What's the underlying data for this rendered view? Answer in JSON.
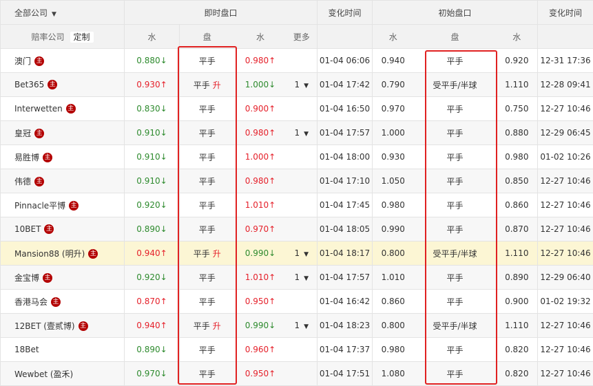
{
  "header": {
    "all_companies": "全部公司",
    "live": "即时盘口",
    "change_time": "变化时间",
    "initial": "初始盘口",
    "change_time2": "变化时间",
    "company": "赔率公司",
    "custom": "定制",
    "water": "水",
    "handicap": "盘",
    "water2": "水",
    "more": "更多",
    "iwater": "水",
    "ihandicap": "盘",
    "iwater2": "水"
  },
  "main_badge": "主",
  "rise_label": "升",
  "rows": [
    {
      "name": "澳门",
      "main": true,
      "w1": "0.880↓",
      "w1d": "down",
      "pan": "平手",
      "rise": false,
      "w2": "0.980↑",
      "w2d": "up",
      "more": "",
      "time": "01-04 06:06",
      "iw1": "0.940",
      "ipan": "平手",
      "iw2": "0.920",
      "itime": "12-31 17:36"
    },
    {
      "name": "Bet365",
      "main": true,
      "w1": "0.930↑",
      "w1d": "up",
      "pan": "平手",
      "rise": true,
      "w2": "1.000↓",
      "w2d": "down",
      "more": "1",
      "time": "01-04 17:42",
      "iw1": "0.790",
      "ipan": "受平手/半球",
      "iw2": "1.110",
      "itime": "12-28 09:41"
    },
    {
      "name": "Interwetten",
      "main": true,
      "w1": "0.830↓",
      "w1d": "down",
      "pan": "平手",
      "rise": false,
      "w2": "0.900↑",
      "w2d": "up",
      "more": "",
      "time": "01-04 16:50",
      "iw1": "0.970",
      "ipan": "平手",
      "iw2": "0.750",
      "itime": "12-27 10:46"
    },
    {
      "name": "皇冠",
      "main": true,
      "w1": "0.910↓",
      "w1d": "down",
      "pan": "平手",
      "rise": false,
      "w2": "0.980↑",
      "w2d": "up",
      "more": "1",
      "time": "01-04 17:57",
      "iw1": "1.000",
      "ipan": "平手",
      "iw2": "0.880",
      "itime": "12-29 06:45"
    },
    {
      "name": "易胜博",
      "main": true,
      "w1": "0.910↓",
      "w1d": "down",
      "pan": "平手",
      "rise": false,
      "w2": "1.000↑",
      "w2d": "up",
      "more": "",
      "time": "01-04 18:00",
      "iw1": "0.930",
      "ipan": "平手",
      "iw2": "0.980",
      "itime": "01-02 10:26"
    },
    {
      "name": "伟德",
      "main": true,
      "w1": "0.910↓",
      "w1d": "down",
      "pan": "平手",
      "rise": false,
      "w2": "0.980↑",
      "w2d": "up",
      "more": "",
      "time": "01-04 17:10",
      "iw1": "1.050",
      "ipan": "平手",
      "iw2": "0.850",
      "itime": "12-27 10:46"
    },
    {
      "name": "Pinnacle平博",
      "main": true,
      "w1": "0.920↓",
      "w1d": "down",
      "pan": "平手",
      "rise": false,
      "w2": "1.010↑",
      "w2d": "up",
      "more": "",
      "time": "01-04 17:45",
      "iw1": "0.980",
      "ipan": "平手",
      "iw2": "0.860",
      "itime": "12-27 10:46"
    },
    {
      "name": "10BET",
      "main": true,
      "w1": "0.890↓",
      "w1d": "down",
      "pan": "平手",
      "rise": false,
      "w2": "0.970↑",
      "w2d": "up",
      "more": "",
      "time": "01-04 18:05",
      "iw1": "0.990",
      "ipan": "平手",
      "iw2": "0.870",
      "itime": "12-27 10:46"
    },
    {
      "name": "Mansion88 (明升)",
      "main": true,
      "w1": "0.940↑",
      "w1d": "up",
      "pan": "平手",
      "rise": true,
      "w2": "0.990↓",
      "w2d": "down",
      "more": "1",
      "time": "01-04 18:17",
      "iw1": "0.800",
      "ipan": "受平手/半球",
      "iw2": "1.110",
      "itime": "12-27 10:46",
      "highlight": true
    },
    {
      "name": "金宝博",
      "main": true,
      "w1": "0.920↓",
      "w1d": "down",
      "pan": "平手",
      "rise": false,
      "w2": "1.010↑",
      "w2d": "up",
      "more": "1",
      "time": "01-04 17:57",
      "iw1": "1.010",
      "ipan": "平手",
      "iw2": "0.890",
      "itime": "12-29 06:40"
    },
    {
      "name": "香港马会",
      "main": true,
      "w1": "0.870↑",
      "w1d": "up",
      "pan": "平手",
      "rise": false,
      "w2": "0.950↑",
      "w2d": "up",
      "more": "",
      "time": "01-04 16:42",
      "iw1": "0.860",
      "ipan": "平手",
      "iw2": "0.900",
      "itime": "01-02 19:32"
    },
    {
      "name": "12BET (壹贰博)",
      "main": true,
      "w1": "0.940↑",
      "w1d": "up",
      "pan": "平手",
      "rise": true,
      "w2": "0.990↓",
      "w2d": "down",
      "more": "1",
      "time": "01-04 18:23",
      "iw1": "0.800",
      "ipan": "受平手/半球",
      "iw2": "1.110",
      "itime": "12-27 10:46"
    },
    {
      "name": "18Bet",
      "main": false,
      "w1": "0.890↓",
      "w1d": "down",
      "pan": "平手",
      "rise": false,
      "w2": "0.960↑",
      "w2d": "up",
      "more": "",
      "time": "01-04 17:37",
      "iw1": "0.980",
      "ipan": "平手",
      "iw2": "0.820",
      "itime": "12-27 10:46"
    },
    {
      "name": "Wewbet (盈禾)",
      "main": false,
      "w1": "0.970↓",
      "w1d": "down",
      "pan": "平手",
      "rise": false,
      "w2": "0.950↑",
      "w2d": "up",
      "more": "",
      "time": "01-04 17:51",
      "iw1": "1.080",
      "ipan": "平手",
      "iw2": "0.820",
      "itime": "12-27 10:46"
    }
  ]
}
